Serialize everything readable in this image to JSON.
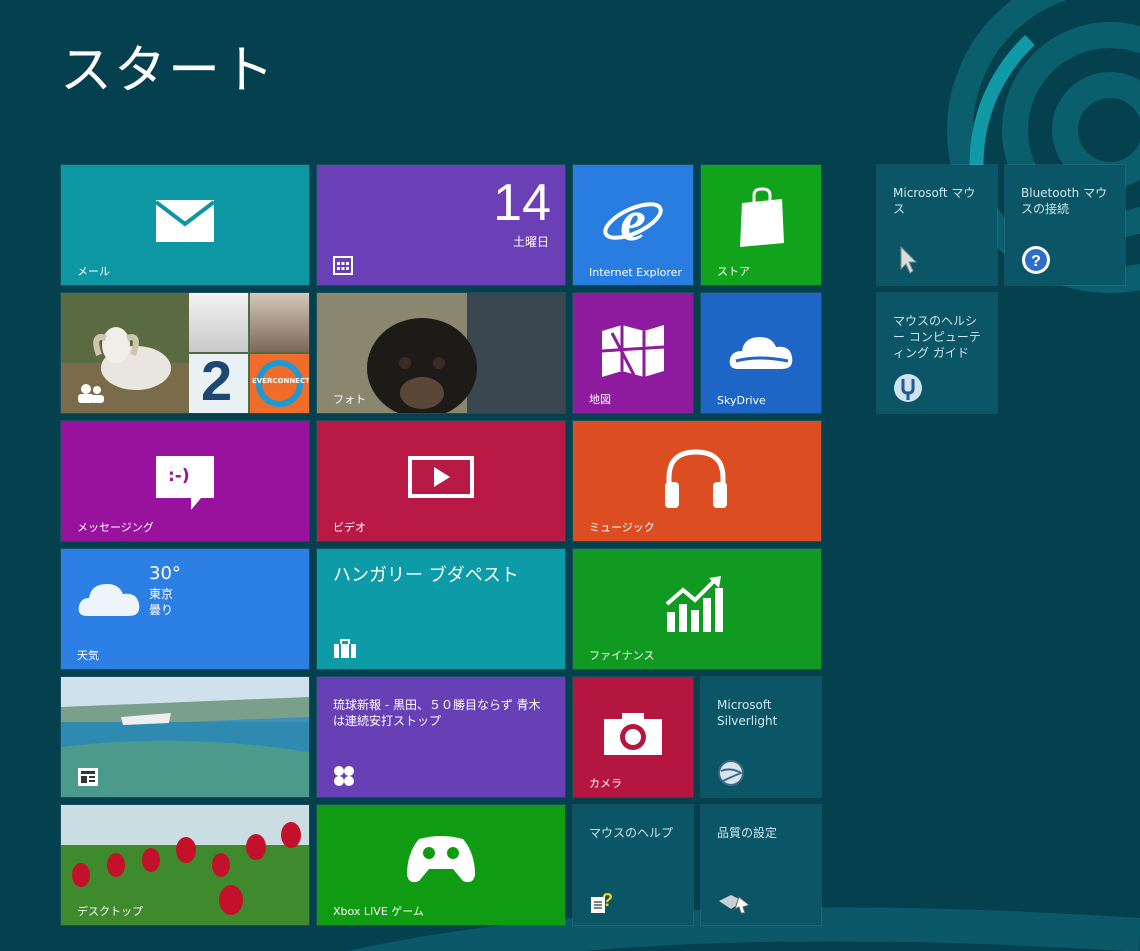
{
  "page": {
    "title": "スタート"
  },
  "tiles": {
    "mail": {
      "label": "メール",
      "color": "#0d97a3"
    },
    "calendar": {
      "day": "14",
      "weekday": "土曜日",
      "color": "#6b3fb5"
    },
    "ie": {
      "label": "Internet Explorer",
      "color": "#2a7de0"
    },
    "store": {
      "label": "ストア",
      "color": "#11a31b"
    },
    "people": {
      "everconnect": "EVERCONNECT",
      "letter": "2"
    },
    "photos": {
      "label": "フォト"
    },
    "maps": {
      "label": "地図",
      "color": "#8e1a9e"
    },
    "skydrive": {
      "label": "SkyDrive",
      "color": "#1d66c6"
    },
    "messaging": {
      "label": "メッセージング",
      "color": "#98129d",
      "emoticon": ":-)"
    },
    "video": {
      "label": "ビデオ",
      "color": "#b81a45"
    },
    "music": {
      "label": "ミュージック",
      "color": "#dc4d21"
    },
    "weather": {
      "label": "天気",
      "temp": "30°",
      "city": "東京",
      "cond": "曇り",
      "color": "#2c7fe4"
    },
    "travel": {
      "title": "ハンガリー ブダペスト",
      "color": "#0e9ba8"
    },
    "finance": {
      "label": "ファイナンス",
      "color": "#109a22"
    },
    "news": {
      "headline": "琉球新報 - 黒田、５０勝目ならず 青木は連続安打ストップ",
      "color": "#6840b5"
    },
    "camera": {
      "label": "カメラ",
      "color": "#b5163f"
    },
    "silverlight": {
      "label": "Microsoft Silverlight"
    },
    "desktop": {
      "label": "デスクトップ"
    },
    "xbox": {
      "label": "Xbox LIVE ゲーム",
      "color": "#0f9b12"
    },
    "mouse_help": {
      "label": "マウスのヘルプ"
    },
    "quality": {
      "label": "品質の設定"
    },
    "ms_mouse": {
      "label": "Microsoft マウス"
    },
    "bt_mouse": {
      "label": "Bluetooth マウスの接続"
    },
    "healthy": {
      "label": "マウスのヘルシー コンピューティング ガイド"
    }
  },
  "icons": {
    "mail": "mail-icon",
    "calendar": "calendar-icon",
    "ie": "internet-explorer-icon",
    "store": "shopping-bag-icon",
    "people": "people-icon",
    "maps": "map-icon",
    "skydrive": "cloud-icon",
    "messaging": "chat-bubble-icon",
    "video": "play-icon",
    "music": "headphones-icon",
    "weather": "cloud-icon",
    "travel": "suitcase-icon",
    "finance": "chart-icon",
    "news": "news-icon",
    "camera": "camera-icon",
    "silverlight": "silverlight-icon",
    "xbox": "xbox-controller-icon",
    "mouse_help": "help-document-icon",
    "quality": "mouse-settings-icon",
    "ms_mouse": "cursor-icon",
    "bt_mouse": "question-icon",
    "healthy": "healthy-mouse-icon"
  },
  "colors": {
    "background": "#05404f",
    "desktop_tile": "#0a5566"
  }
}
